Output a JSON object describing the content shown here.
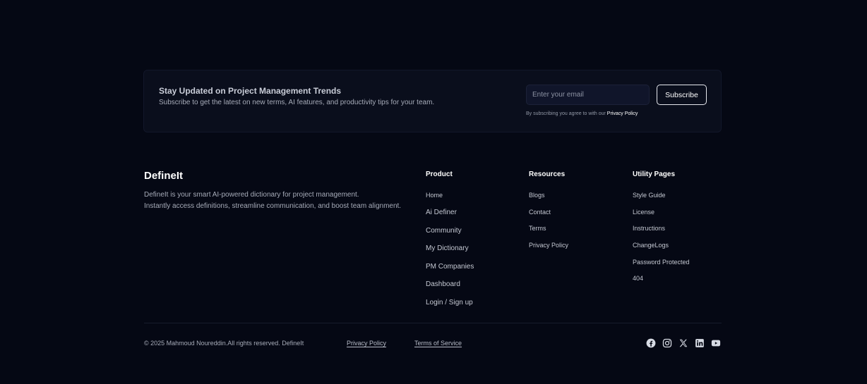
{
  "newsletter": {
    "title": "Stay Updated on Project Management Trends",
    "subtitle": "Subscribe to get the latest on new terms, AI features, and productivity tips for your team.",
    "email_placeholder": "Enter your email",
    "subscribe_label": "Subscribe",
    "terms_text": "By subscribing you agree to with our ",
    "terms_link": "Privacy Policy"
  },
  "brand": {
    "name": "DefineIt",
    "description_line1": "DefineIt is your smart AI-powered dictionary for project management.",
    "description_line2": "Instantly access definitions, streamline communication, and boost team alignment."
  },
  "columns": {
    "product": {
      "title": "Product",
      "items": [
        "Home",
        "Ai Definer",
        "Community",
        "My Dictionary",
        "PM Companies",
        "Dashboard",
        "Login / Sign up"
      ]
    },
    "resources": {
      "title": "Resources",
      "items": [
        "Blogs",
        "Contact",
        "Terms",
        "Privacy Policy"
      ]
    },
    "utility": {
      "title": "Utility Pages",
      "items": [
        "Style Guide",
        "License",
        "Instructions",
        "ChangeLogs",
        "Password Protected",
        "404"
      ]
    }
  },
  "bottom": {
    "copyright": "© 2025 Mahmoud Noureddin.All rights reserved. DefineIt",
    "privacy_label": "Privacy Policy",
    "terms_label": "Terms of Service",
    "social_icons": [
      "facebook-icon",
      "instagram-icon",
      "x-icon",
      "linkedin-icon",
      "youtube-icon"
    ]
  },
  "colors": {
    "background": "#050814",
    "card": "#0a0e1c",
    "text_primary": "#ffffff",
    "text_muted": "#a6abb8"
  }
}
